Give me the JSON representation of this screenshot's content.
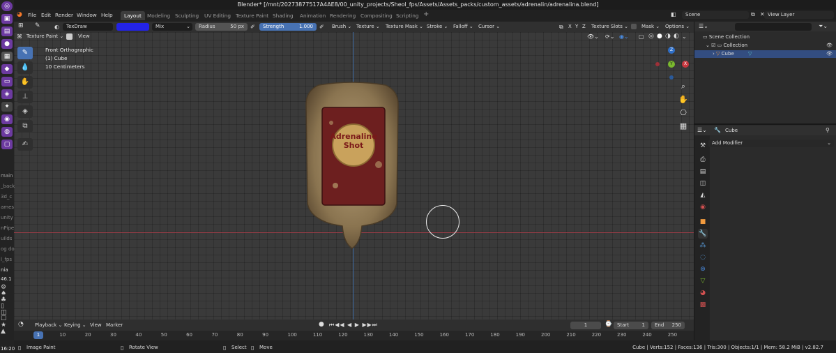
{
  "window": {
    "title": "Blender* [/mnt/20273877517A4AE8/00_unity_projects/Sheol_fps/Assets/Assets_packs/custom_assets/adrenalin/adrenalina.blend]"
  },
  "dock": {
    "labels": [
      "main",
      "_back",
      "3d_c",
      "ames",
      "unity",
      "nPipe",
      "uilds",
      "og do",
      "l_fps",
      "nia"
    ],
    "clock": "16:20",
    "badge": "46.1"
  },
  "menu": {
    "items": [
      "File",
      "Edit",
      "Render",
      "Window",
      "Help"
    ],
    "workspaces": [
      "Layout",
      "Modeling",
      "Sculpting",
      "UV Editing",
      "Texture Paint",
      "Shading",
      "Animation",
      "Rendering",
      "Compositing",
      "Scripting"
    ],
    "active_workspace": "Layout",
    "add": "+",
    "scene": "Scene",
    "view_layer": "View Layer"
  },
  "tool_header": {
    "brush_name": "TexDraw",
    "color": "#2323e6",
    "blend": "Mix",
    "radius_label": "Radius",
    "radius_value": "50 px",
    "strength_label": "Strength",
    "strength_value": "1.000",
    "menus": [
      "Brush",
      "Texture",
      "Texture Mask",
      "Stroke",
      "Falloff",
      "Cursor"
    ],
    "axes": [
      "X",
      "Y",
      "Z"
    ],
    "texture_slots": "Texture Slots",
    "mask": "Mask",
    "options": "Options"
  },
  "view_header": {
    "mode": "Texture Paint",
    "view": "View"
  },
  "viewport": {
    "view_name": "Front Orthographic",
    "object_line": "(1) Cube",
    "scale": "10 Centimeters",
    "label_line1": "Adrenaline",
    "label_line2": "Shot",
    "gizmo_x": "X",
    "gizmo_y": "Y",
    "gizmo_z": "Z"
  },
  "timeline_header": {
    "items": [
      "Playback",
      "Keying",
      "View",
      "Marker"
    ],
    "current_frame": "1",
    "start_label": "Start",
    "start": "1",
    "end_label": "End",
    "end": "250"
  },
  "timeline": {
    "current": "1",
    "ticks": [
      "10",
      "20",
      "30",
      "40",
      "50",
      "60",
      "70",
      "80",
      "90",
      "100",
      "110",
      "120",
      "130",
      "140",
      "150",
      "160",
      "170",
      "180",
      "190",
      "200",
      "210",
      "220",
      "230",
      "240",
      "250"
    ]
  },
  "status": {
    "left": "Image Paint",
    "mid1": "Rotate View",
    "mid2": "Select",
    "mid3": "Move",
    "right": "Cube | Verts:152 | Faces:136 | Tris:300 | Objects:1/1 | Mem: 58.2 MiB | v2.82.7"
  },
  "outliner": {
    "root": "Scene Collection",
    "collection": "Collection",
    "object": "Cube"
  },
  "properties": {
    "object": "Cube",
    "add_modifier": "Add Modifier"
  }
}
